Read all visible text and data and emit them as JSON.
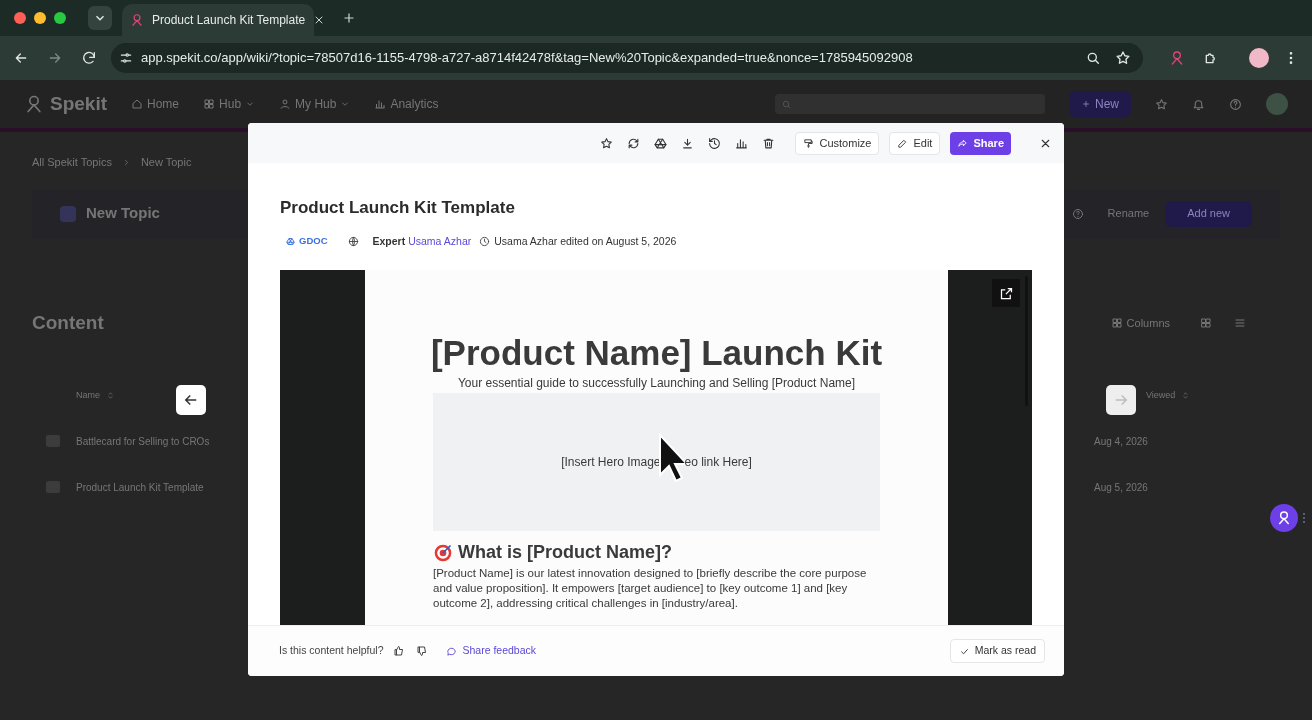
{
  "browser": {
    "tab_title": "Product Launch Kit Template",
    "url": "app.spekit.co/app/wiki/?topic=78507d16-1155-4798-a727-a8714f42478f&tag=New%20Topic&expanded=true&nonce=1785945092908"
  },
  "app": {
    "logo": "Spekit",
    "nav": [
      {
        "label": "Home",
        "dropdown": false
      },
      {
        "label": "Hub",
        "dropdown": true
      },
      {
        "label": "My Hub",
        "dropdown": true
      },
      {
        "label": "Analytics",
        "dropdown": false
      }
    ],
    "new_button": "New",
    "breadcrumb": [
      "All Spekit Topics",
      "New Topic"
    ],
    "topic_title": "New Topic",
    "rename_button": "Rename",
    "add_new_button": "Add new",
    "content_heading": "Content",
    "columns_button": "Columns",
    "table": {
      "columns": [
        "Name",
        "Viewed"
      ],
      "rows": [
        {
          "name": "Battlecard for Selling to CROs",
          "viewed": "Aug 4, 2026"
        },
        {
          "name": "Product Launch Kit Template",
          "viewed": "Aug 5, 2026"
        }
      ]
    }
  },
  "navigation": {
    "previous_disabled": false,
    "next_disabled": true
  },
  "modal": {
    "actions": [
      "Customize",
      "Edit",
      "Share"
    ],
    "title": "Product Launch Kit Template",
    "meta": {
      "source_badge": "GDOC",
      "expert_label": "Expert",
      "expert_name": "Usama Azhar",
      "edited": "Usama Azhar edited on August 5, 2026"
    },
    "document": {
      "heading": "[Product Name] Launch Kit",
      "subtitle": "Your essential guide to successfully Launching and Selling [Product Name]",
      "hero_placeholder": [
        "[Insert Hero Image",
        "eo link Here]"
      ],
      "section_heading": "What is [Product Name]?",
      "paragraph": "[Product Name] is our latest innovation designed to [briefly describe the core purpose and value proposition]. It empowers [target audience] to [key outcome 1] and [key outcome 2], addressing critical challenges in [industry/area]."
    },
    "footer": {
      "question": "Is this content helpful?",
      "feedback_link": "Share feedback",
      "mark_read": "Mark as read"
    }
  }
}
